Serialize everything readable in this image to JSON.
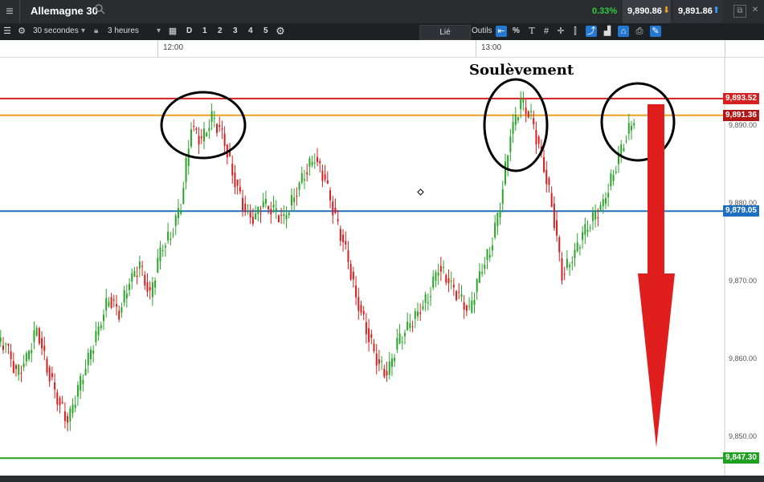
{
  "header": {
    "menu_icon": "hamburger-icon",
    "title": "Allemagne 30",
    "search_icon": "search-icon",
    "change": "0.33%",
    "bid": "9,890.86",
    "ask": "9,891.86"
  },
  "toolbar": {
    "interval": "30 secondes",
    "range": "3 heures",
    "periods": [
      "D",
      "1",
      "2",
      "3",
      "4",
      "5"
    ],
    "link": "Lié",
    "tools": "Outils",
    "percent": "%"
  },
  "time_axis": {
    "ticks": [
      "12:00",
      "13:00"
    ]
  },
  "annotation": "Soulèvement",
  "price_lines": [
    {
      "label": "9,893.52",
      "value": 9893.52,
      "color": "#d42020"
    },
    {
      "label": "9,891.36",
      "value": 9891.36,
      "color": "#f0a020"
    },
    {
      "label": "9,879.05",
      "value": 9879.05,
      "color": "#1f6fc0"
    },
    {
      "label": "9,847.30",
      "value": 9847.3,
      "color": "#20a020"
    }
  ],
  "chart_data": {
    "type": "candlestick",
    "title": "Allemagne 30",
    "xlabel": "",
    "ylabel": "",
    "x_ticks": [
      "12:00",
      "13:00"
    ],
    "y_ticks": [
      "9,890.00",
      "9,880.00",
      "9,870.00",
      "9,860.00",
      "9,850.00"
    ],
    "y_tick_values": [
      9890,
      9880,
      9870,
      9860,
      9850
    ],
    "ylim": [
      9846,
      9900
    ],
    "approx_close_series": [
      9862,
      9858,
      9860,
      9864,
      9859,
      9855,
      9852,
      9856,
      9860,
      9864,
      9868,
      9866,
      9870,
      9872,
      9868,
      9874,
      9876,
      9880,
      9890,
      9888,
      9891,
      9889,
      9884,
      9880,
      9878,
      9880,
      9879,
      9878,
      9881,
      9884,
      9886,
      9883,
      9878,
      9874,
      9868,
      9864,
      9860,
      9858,
      9862,
      9864,
      9866,
      9868,
      9872,
      9870,
      9868,
      9866,
      9871,
      9874,
      9880,
      9889,
      9893,
      9891,
      9886,
      9880,
      9871,
      9873,
      9876,
      9878,
      9880,
      9884,
      9888,
      9891
    ]
  }
}
